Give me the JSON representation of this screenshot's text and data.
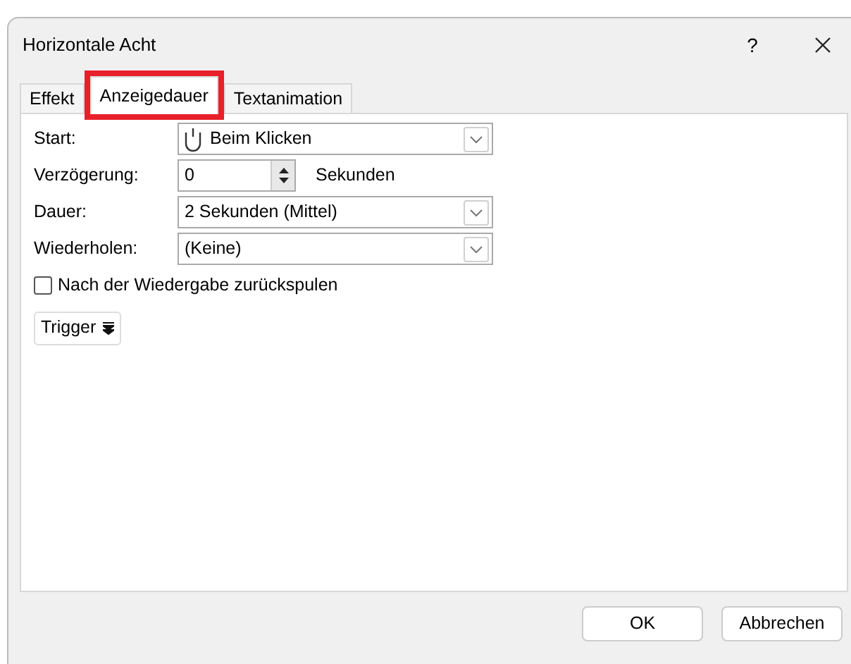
{
  "window": {
    "title": "Horizontale Acht",
    "help": "?"
  },
  "tabs": [
    {
      "label": "Effekt",
      "selected": false,
      "highlighted": false
    },
    {
      "label": "Anzeigedauer",
      "selected": true,
      "highlighted": true
    },
    {
      "label": "Textanimation",
      "selected": false,
      "highlighted": false
    }
  ],
  "fields": [
    {
      "kind": "dropdown",
      "label": "Start:",
      "value": "Beim Klicken"
    },
    {
      "kind": "spinner",
      "label": "Verzögerung:",
      "value": "0",
      "unit": "Sekunden"
    },
    {
      "kind": "dropdown",
      "label": "Dauer:",
      "value": "2 Sekunden (Mittel)"
    },
    {
      "kind": "dropdown",
      "label": "Wiederholen:",
      "value": "(Keine)"
    }
  ],
  "rewind": {
    "label": "Nach der Wiedergabe zurückspulen",
    "checked": false
  },
  "trigger_button": "Trigger",
  "buttons": [
    "OK",
    "Abbrechen"
  ]
}
